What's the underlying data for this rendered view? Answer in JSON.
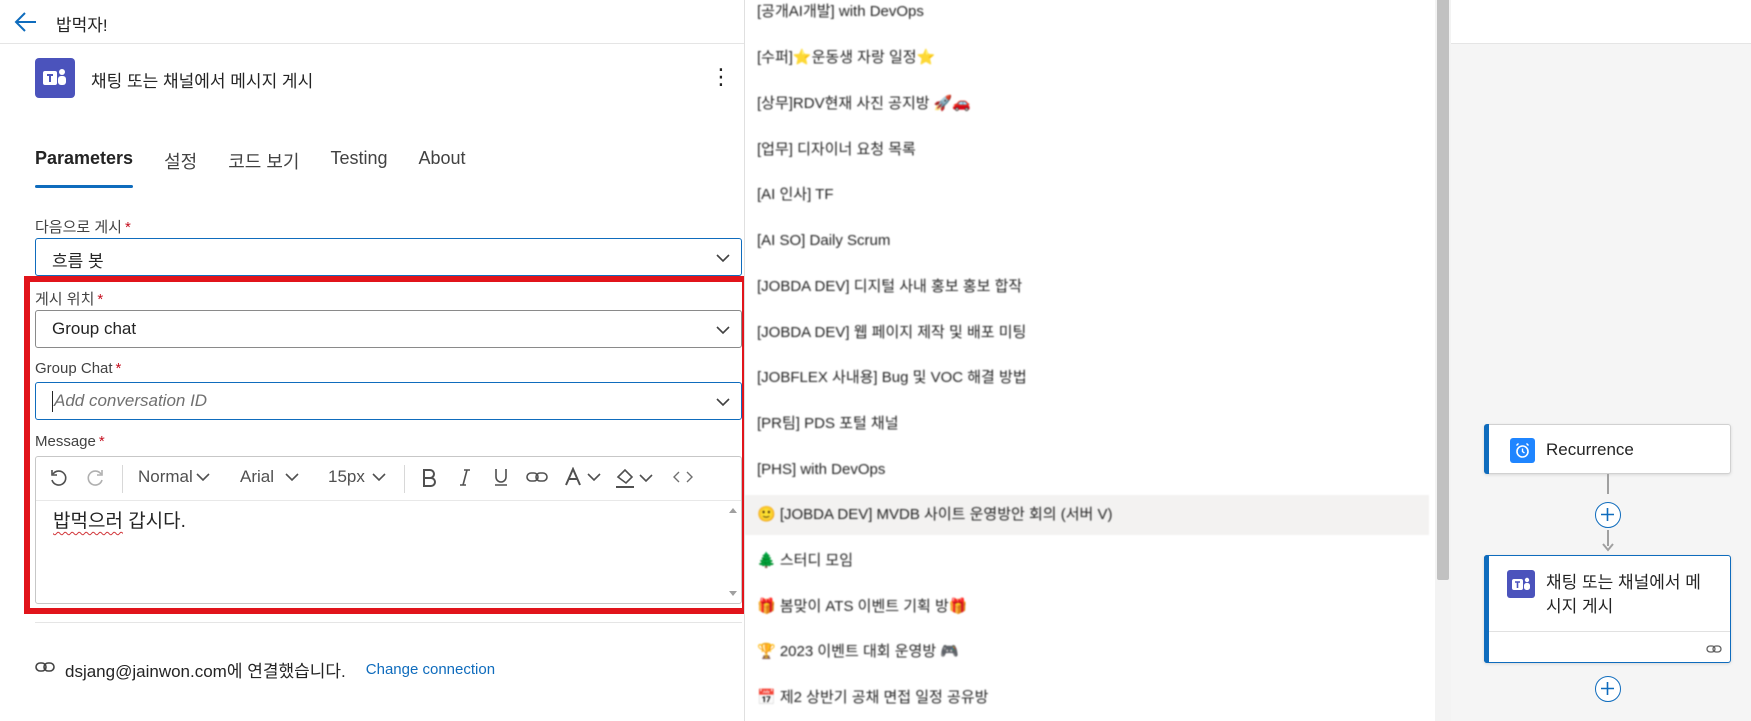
{
  "topbar": {
    "title": "밥먹자!"
  },
  "action": {
    "title": "채팅 또는 채널에서 메시지 게시",
    "more_label": "⋮"
  },
  "tabs": [
    {
      "label": "Parameters"
    },
    {
      "label": "설정"
    },
    {
      "label": "코드 보기"
    },
    {
      "label": "Testing"
    },
    {
      "label": "About"
    }
  ],
  "fields": {
    "post_as": {
      "label": "다음으로 게시",
      "required": "*",
      "value": "흐름 봇"
    },
    "post_in": {
      "label": "게시 위치",
      "required": "*",
      "value": "Group chat"
    },
    "group_chat": {
      "label": "Group Chat",
      "required": "*",
      "placeholder": "Add conversation ID"
    },
    "message": {
      "label": "Message",
      "required": "*"
    }
  },
  "editor": {
    "format": "Normal",
    "font": "Arial",
    "size": "15px",
    "text_squiggle": "밥먹으러",
    "text_rest": " 갑시다."
  },
  "connection": {
    "text": "dsjang@jainwon.com에 연결했습니다.",
    "change_label": "Change connection"
  },
  "list_items": [
    "[공개AI개발] with DevOps",
    "[수퍼]⭐운동생 자랑 일정⭐",
    "[상무]RDV현재 사진 공지방 🚀🚗",
    "[업무] 디자이너 요청 목록",
    "[AI 인사] TF",
    "[AI SO] Daily Scrum",
    "[JOBDA DEV] 디지털 사내 홍보 홍보 합작",
    "[JOBDA DEV] 웹 페이지 제작 및 배포 미팅",
    "[JOBFLEX 사내용] Bug 및 VOC 해결 방법",
    "[PR팀] PDS 포털 채널",
    "[PHS] with DevOps",
    "🙂 [JOBDA DEV] MVDB 사이트 운영방안 회의 (서버 V)",
    "🌲 스터디 모임",
    "🎁 봄맞이 ATS 이벤트 기획 방🎁",
    "🏆 2023 이벤트 대회 운영방 🎮",
    "📅 제2 상반기 공채 면접 일정 공유방"
  ],
  "canvas": {
    "recurrence_title": "Recurrence",
    "post_title_line1": "채팅 또는 채널에서 메",
    "post_title_line2": "시지 게시"
  },
  "colors": {
    "accent": "#0f6cbd",
    "teams": "#4b53bc",
    "highlight": "#e1141b",
    "required": "#c50f1f"
  }
}
